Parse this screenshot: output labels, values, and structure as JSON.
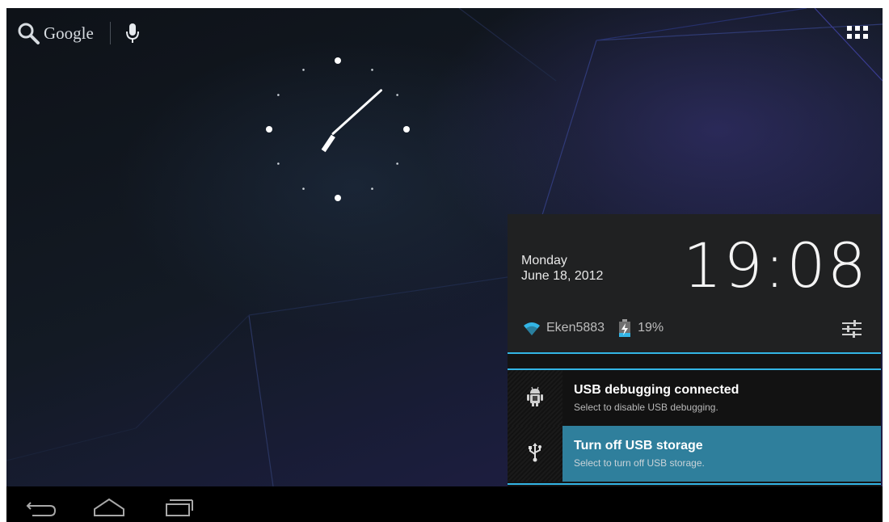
{
  "search_bar": {
    "label": "Google",
    "icons": [
      "search-icon",
      "mic-icon"
    ]
  },
  "apps_button": {
    "icon": "apps-grid-icon"
  },
  "analog_clock": {
    "hour": 7,
    "minute": 8
  },
  "notification_panel": {
    "day": "Monday",
    "date": "June 18, 2012",
    "time": "19:08",
    "wifi_name": "Eken5883",
    "battery_level": "19%",
    "accent_color": "#33b5e5",
    "notifications": [
      {
        "icon": "android-debug-icon",
        "title": "USB debugging connected",
        "text": "Select to disable USB debugging."
      },
      {
        "icon": "usb-icon",
        "title": "Turn off USB storage",
        "text": "Select to turn off USB storage."
      }
    ]
  },
  "nav_bar": {
    "buttons": [
      "back-icon",
      "home-icon",
      "recent-apps-icon"
    ]
  }
}
